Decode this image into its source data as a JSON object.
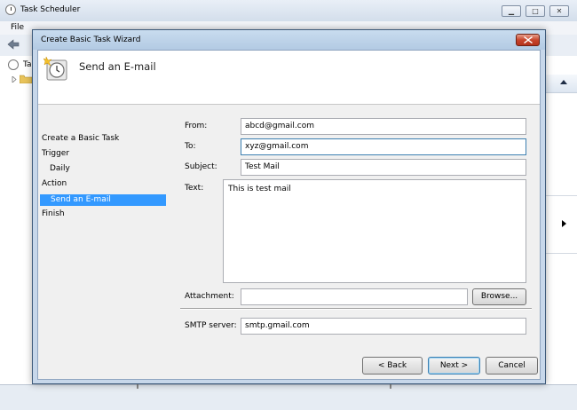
{
  "background": {
    "window_title": "Task Scheduler",
    "menu_file": "File",
    "tree_label": "Ta",
    "controls": {
      "minimize": "▁",
      "maximize": "□",
      "close": "✕"
    }
  },
  "dialog": {
    "title": "Create Basic Task Wizard",
    "header_title": "Send an E-mail"
  },
  "nav": {
    "items": [
      {
        "label": "Create a Basic Task",
        "level": 0,
        "selected": false
      },
      {
        "label": "Trigger",
        "level": 0,
        "selected": false
      },
      {
        "label": "Daily",
        "level": 1,
        "selected": false
      },
      {
        "label": "Action",
        "level": 0,
        "selected": false
      },
      {
        "label": "Send an E-mail",
        "level": 1,
        "selected": true
      },
      {
        "label": "Finish",
        "level": 0,
        "selected": false
      }
    ]
  },
  "form": {
    "from": {
      "label": "From:",
      "value": "abcd@gmail.com"
    },
    "to": {
      "label": "To:",
      "value": "xyz@gmail.com"
    },
    "subject": {
      "label": "Subject:",
      "value": "Test Mail"
    },
    "text": {
      "label": "Text:",
      "value": "This is test mail"
    },
    "attachment": {
      "label": "Attachment:",
      "value": ""
    },
    "browse_label": "Browse...",
    "smtp": {
      "label": "SMTP server:",
      "value": "smtp.gmail.com"
    }
  },
  "buttons": {
    "back": "< Back",
    "next": "Next >",
    "cancel": "Cancel"
  },
  "colors": {
    "selection": "#3399ff",
    "dialog_frame": "#c7d7ea",
    "close_button": "#c8452c"
  }
}
